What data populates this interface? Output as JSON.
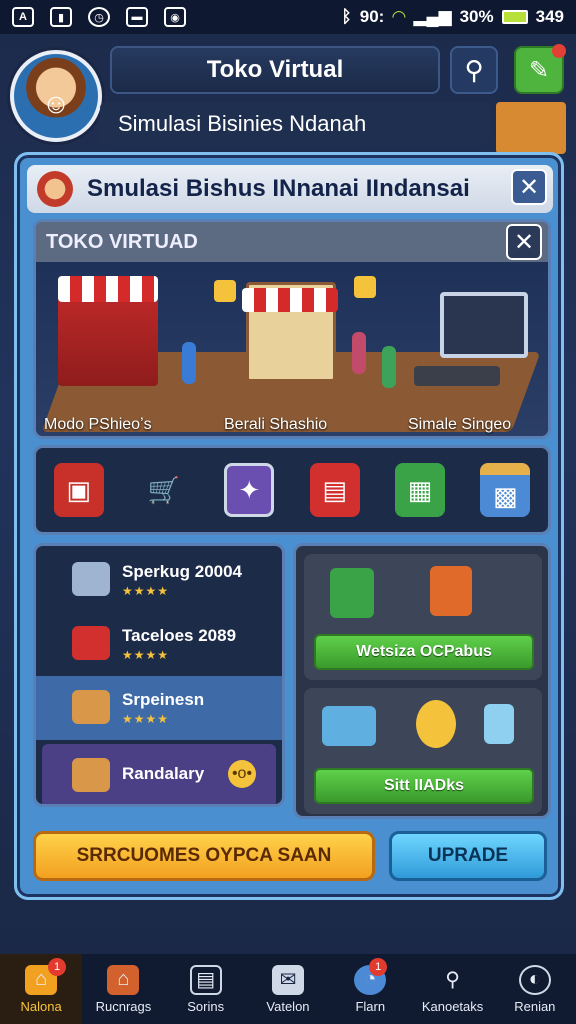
{
  "status": {
    "left_icons": [
      "signal-a-icon",
      "sim-icon",
      "clock-icon",
      "tv-icon",
      "cast-icon"
    ],
    "network": "90:",
    "battery": "30%",
    "time": "349"
  },
  "header": {
    "title": "Toko Virtual",
    "subtitle": "Simulasi Bisinies Ndanah"
  },
  "panel": {
    "title": "Smulasi Bishus INnanai IIndansai",
    "inner_title": "TOKO VIRTUAD",
    "scene_labels": [
      "Modo PShieoʼs",
      "Berali Shashio",
      "Simale Singeo"
    ]
  },
  "icons": [
    "store-icon",
    "cart-icon",
    "tablet-icon",
    "bag-icon",
    "crate-icon",
    "box-icon"
  ],
  "list": [
    {
      "label": "Sperkug 20004",
      "stars": "★★★★"
    },
    {
      "label": "Taceloes 2089",
      "stars": "★★★★"
    },
    {
      "label": "Srpeinesn",
      "stars": "★★★★"
    },
    {
      "label": "Randalary",
      "stars": ""
    }
  ],
  "right": {
    "btn1": "Wetsiza OCPabus",
    "btn2": "Sitt IIADks",
    "close": "×"
  },
  "actions": {
    "primary": "SRRCUOMES OYPCA SAAN",
    "upgrade": "UPRADE"
  },
  "nav": [
    {
      "label": "Nalona",
      "badge": "1"
    },
    {
      "label": "Rucnrags",
      "badge": ""
    },
    {
      "label": "Sorins",
      "badge": ""
    },
    {
      "label": "Vatelon",
      "badge": ""
    },
    {
      "label": "Flarn",
      "badge": "1"
    },
    {
      "label": "Kanoetaks",
      "badge": ""
    },
    {
      "label": "Renian",
      "badge": ""
    }
  ],
  "colors": {
    "accent": "#4a90d0",
    "primary_btn": "#f2a020",
    "upgrade_btn": "#2f9ad8",
    "green": "#3a9a2c"
  }
}
